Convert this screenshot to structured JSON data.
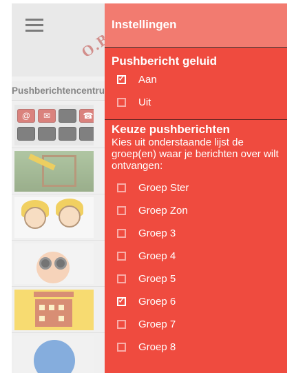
{
  "app": {
    "logo_text": "O.B",
    "section_title": "Pushberichtencentrum",
    "key_labels": [
      "@",
      "✉",
      "☎"
    ]
  },
  "drawer": {
    "title": "Instellingen",
    "sound": {
      "heading": "Pushbericht geluid",
      "options": [
        {
          "label": "Aan",
          "checked": true
        },
        {
          "label": "Uit",
          "checked": false
        }
      ]
    },
    "groups": {
      "heading": "Keuze pushberichten",
      "description": "Kies uit onderstaande lijst de groep(en) waar je berichten over wilt ontvangen:",
      "options": [
        {
          "label": "Groep Ster",
          "checked": false
        },
        {
          "label": "Groep  Zon",
          "checked": false
        },
        {
          "label": "Groep 3",
          "checked": false
        },
        {
          "label": "Groep 4",
          "checked": false
        },
        {
          "label": "Groep 5",
          "checked": false
        },
        {
          "label": "Groep 6",
          "checked": true
        },
        {
          "label": "Groep 7",
          "checked": false
        },
        {
          "label": "Groep 8",
          "checked": false
        }
      ]
    }
  },
  "colors": {
    "drawer_bg": "#ef4b3f",
    "drawer_header": "#f27b70",
    "text_on_drawer": "#ffffff"
  },
  "icons": {
    "menu": "hamburger-menu-icon",
    "checked": "checkbox-checked-icon",
    "unchecked": "checkbox-unchecked-icon"
  }
}
